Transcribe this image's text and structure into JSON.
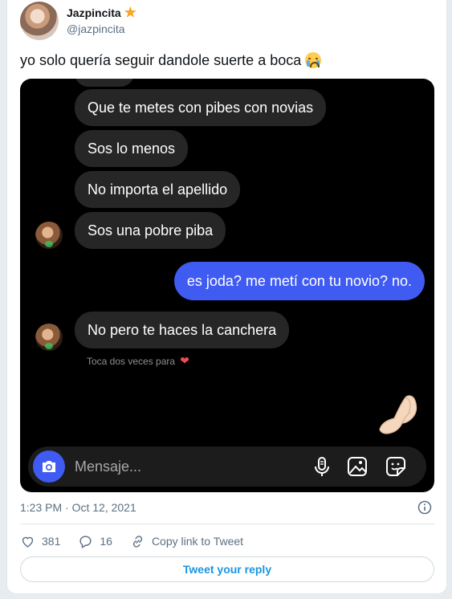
{
  "user": {
    "name": "Jazpincita",
    "handle": "@jazpincita",
    "badge_icon": "star-emoji"
  },
  "tweet": {
    "text": "yo solo quería seguir dandole suerte a boca",
    "emoji": "crying-face-emoji"
  },
  "chat": {
    "received": [
      "Que te metes con pibes con novias",
      "Sos lo menos",
      "No importa el apellido",
      "Sos una pobre piba"
    ],
    "sent": "es joda? me metí con tu novio? no.",
    "last_received": "No pero te haces la canchera",
    "hint": "Toca dos veces para",
    "composer_placeholder": "Mensaje..."
  },
  "meta": {
    "timestamp": "1:23 PM · Oct 12, 2021"
  },
  "actions": {
    "likes": "381",
    "replies": "16",
    "copy_link": "Copy link to Tweet"
  },
  "reply_button": "Tweet your reply",
  "colors": {
    "sent_bubble": "#3f5bf2",
    "received_bubble": "#262626",
    "link": "#1b95e0",
    "like_heart": "#ed4956"
  }
}
